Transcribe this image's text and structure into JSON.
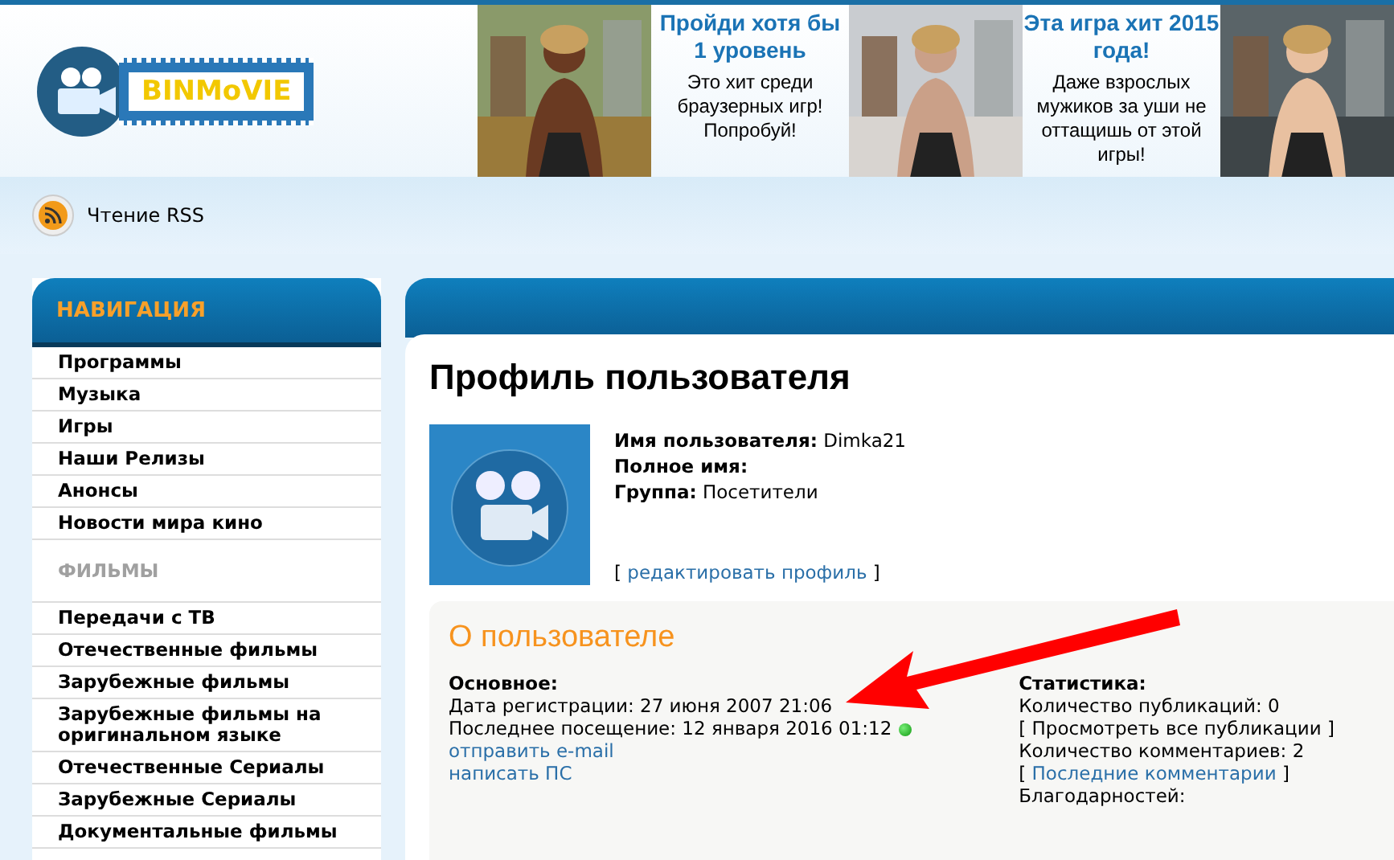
{
  "logo": {
    "text": "BINMoVIE"
  },
  "ads": [
    {
      "kind": "picture"
    },
    {
      "kind": "promo",
      "title": "Пройди хотя бы 1 уровень",
      "text": "Это хит среди браузерных игр! Попробуй!"
    },
    {
      "kind": "picture"
    },
    {
      "kind": "promo",
      "title": "Эта игра хит 2015 года!",
      "text": "Даже взрослых мужиков за уши не оттащишь от этой игры!"
    },
    {
      "kind": "picture"
    }
  ],
  "rss": {
    "label": "Чтение RSS"
  },
  "sidebar": {
    "title": "НАВИГАЦИЯ",
    "items": [
      {
        "kind": "item",
        "label": "Программы"
      },
      {
        "kind": "item",
        "label": "Музыка"
      },
      {
        "kind": "item",
        "label": "Игры"
      },
      {
        "kind": "item",
        "label": "Наши Релизы"
      },
      {
        "kind": "item",
        "label": "Анонсы"
      },
      {
        "kind": "item",
        "label": "Новости мира кино"
      },
      {
        "kind": "heading",
        "label": "ФИЛЬМЫ"
      },
      {
        "kind": "item",
        "label": "Передачи с ТВ"
      },
      {
        "kind": "item",
        "label": "Отечественные фильмы"
      },
      {
        "kind": "item",
        "label": "Зарубежные фильмы"
      },
      {
        "kind": "item",
        "label": "Зарубежные фильмы на оригинальном языке"
      },
      {
        "kind": "item",
        "label": "Отечественные Сериалы"
      },
      {
        "kind": "item",
        "label": "Зарубежные Сериалы"
      },
      {
        "kind": "item",
        "label": "Документальные фильмы"
      }
    ]
  },
  "profile": {
    "title": "Профиль пользователя",
    "fields": [
      {
        "label": "Имя пользователя:",
        "value": "Dimka21"
      },
      {
        "label": "Полное имя:"
      },
      {
        "label": "Группа:",
        "value": "Посетители"
      }
    ],
    "edit_link": {
      "open": "[",
      "label": "редактировать профиль",
      "close": "]"
    }
  },
  "about": {
    "title": "О пользователе",
    "basic": {
      "heading": "Основное:",
      "lines": [
        {
          "kind": "text",
          "text": "Дата регистрации: 27 июня 2007 21:06"
        },
        {
          "kind": "text",
          "text": "Последнее посещение: 12 января 2016 01:12",
          "online": true
        },
        {
          "kind": "link",
          "text": "отправить e-mail"
        },
        {
          "kind": "link",
          "text": "написать ПС"
        }
      ]
    },
    "stats": {
      "heading": "Статистика:",
      "lines": [
        {
          "kind": "text",
          "text": "Количество публикаций: 0"
        },
        {
          "kind": "link",
          "open": "[",
          "text": "Просмотреть все публикации",
          "close": "]",
          "visited": true
        },
        {
          "kind": "text",
          "text": "Количество комментариев: 2"
        },
        {
          "kind": "link",
          "open": "[",
          "text": "Последние комментарии",
          "close": "]",
          "visited": false
        },
        {
          "kind": "text",
          "text": "Благодарностей:"
        }
      ]
    }
  }
}
